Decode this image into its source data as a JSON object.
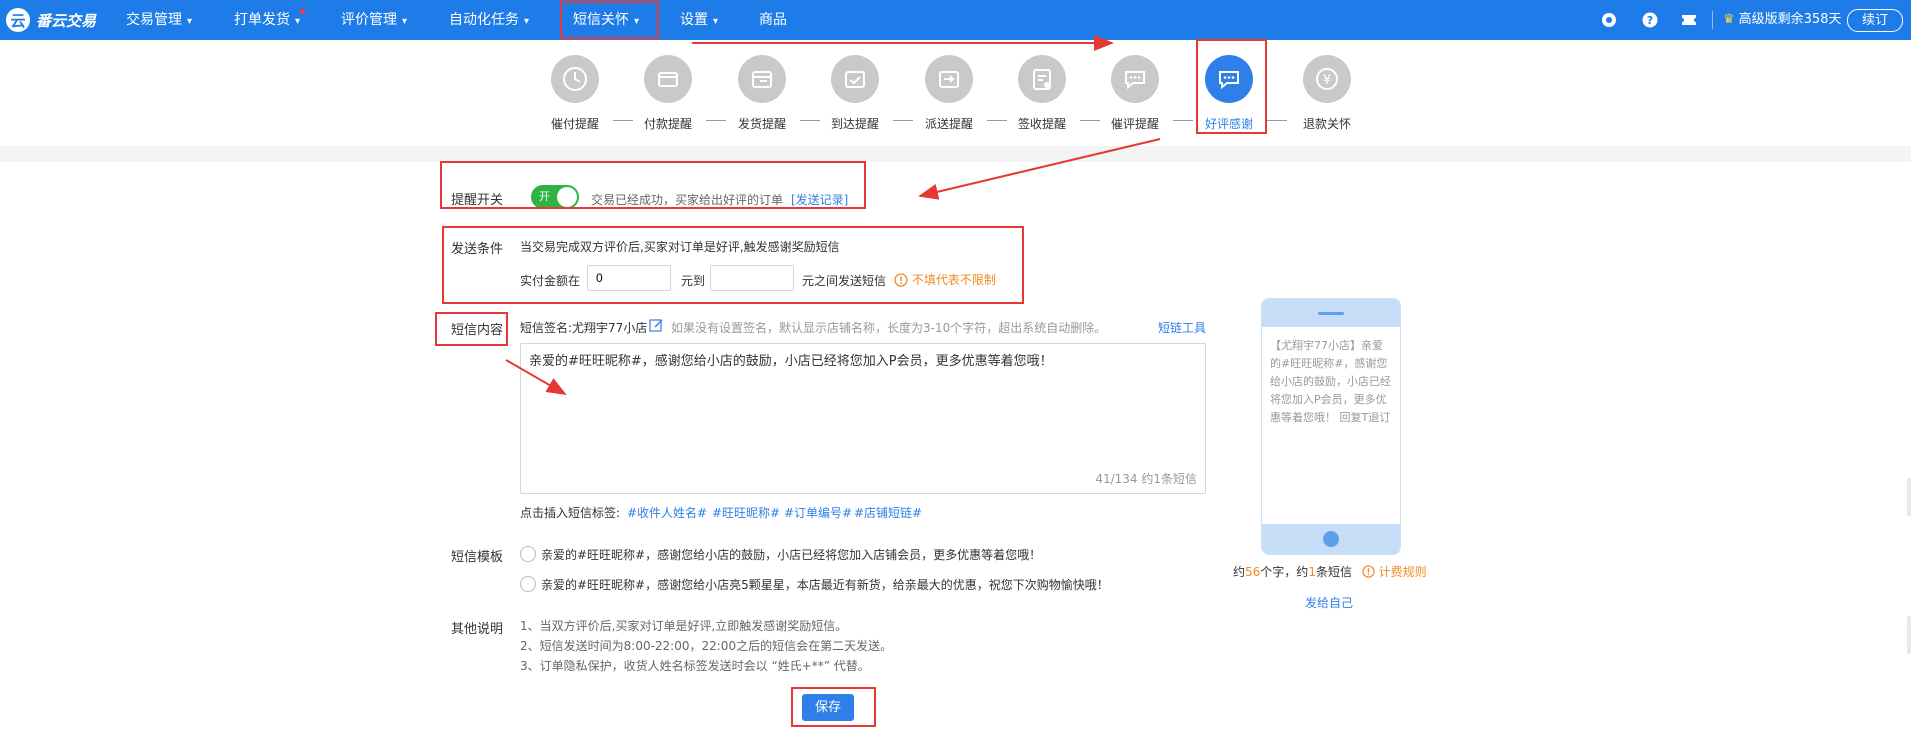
{
  "topbar": {
    "logo_text": "番云交易",
    "nav": [
      {
        "label": "交易管理"
      },
      {
        "label": "打单发货"
      },
      {
        "label": "评价管理"
      },
      {
        "label": "自动化任务"
      },
      {
        "label": "短信关怀"
      },
      {
        "label": "设置"
      },
      {
        "label": "商品"
      }
    ],
    "plan_text": "高级版剩余358天",
    "renew_label": "续订"
  },
  "steps": [
    {
      "label": "催付提醒",
      "icon": "clock-icon"
    },
    {
      "label": "付款提醒",
      "icon": "wallet-icon"
    },
    {
      "label": "发货提醒",
      "icon": "box-icon"
    },
    {
      "label": "到达提醒",
      "icon": "check-box-icon"
    },
    {
      "label": "派送提醒",
      "icon": "truck-icon"
    },
    {
      "label": "签收提醒",
      "icon": "sign-icon"
    },
    {
      "label": "催评提醒",
      "icon": "chat-icon"
    },
    {
      "label": "好评感谢",
      "icon": "thanks-chat-icon",
      "active": true
    },
    {
      "label": "退款关怀",
      "icon": "refund-icon"
    }
  ],
  "form": {
    "reminder_label": "提醒开关",
    "toggle_text": "开",
    "reminder_desc": "交易已经成功，买家给出好评的订单",
    "send_log_link": "[发送记录]",
    "condition_label": "发送条件",
    "condition_desc": "当交易完成双方评价后,买家对订单是好评,触发感谢奖励短信",
    "amount_prefix": "实付金额在",
    "amount_min": "0",
    "amount_middle": "元到",
    "amount_max": "",
    "amount_suffix": "元之间发送短信",
    "amount_hint": "不填代表不限制",
    "content_label": "短信内容",
    "signature_text": "短信签名:尤翔宇77小店",
    "signature_hint": "如果没有设置签名，默认显示店铺名称，长度为3-10个字符，超出系统自动删除。",
    "link_tool": "短链工具",
    "sms_content": "亲爱的#旺旺昵称#，感谢您给小店的鼓励，小店已经将您加入P会员，更多优惠等着您哦！",
    "char_count": "41/134  约1条短信",
    "insert_tags_label": "点击插入短信标签:",
    "tags": [
      "#收件人姓名#",
      "#旺旺昵称#",
      "#订单编号#",
      "#店铺短链#"
    ],
    "template_label": "短信模板",
    "templates": [
      "亲爱的#旺旺昵称#，感谢您给小店的鼓励，小店已经将您加入店铺会员，更多优惠等着您哦！",
      "亲爱的#旺旺昵称#，感谢您给小店亮5颗星星，本店最近有新货，给亲最大的优惠，祝您下次购物愉快哦！"
    ],
    "notes_label": "其他说明",
    "notes": [
      "1、当双方评价后,买家对订单是好评,立即触发感谢奖励短信。",
      "2、短信发送时间为8:00-22:00，22:00之后的短信会在第二天发送。",
      "3、订单隐私保护，收货人姓名标签发送时会以 “姓氏+**” 代替。"
    ],
    "save_label": "保存"
  },
  "preview": {
    "phone_text": "【尤翔宇77小店】亲爱的#旺旺昵称#，感谢您给小店的鼓励，小店已经将您加入P会员，更多优惠等着您哦！ 回复T退订",
    "count_prefix": "约",
    "chars": "56",
    "count_mid": "个字，约",
    "msgs": "1",
    "count_suffix": "条短信",
    "rule_link": "计费规则",
    "send_self": "发给自己"
  },
  "colors": {
    "brand": "#1e7ce8",
    "active_step": "#2f7fea",
    "toggle_on": "#2fb344",
    "warning": "#f08a24",
    "annotation": "#e53935"
  }
}
